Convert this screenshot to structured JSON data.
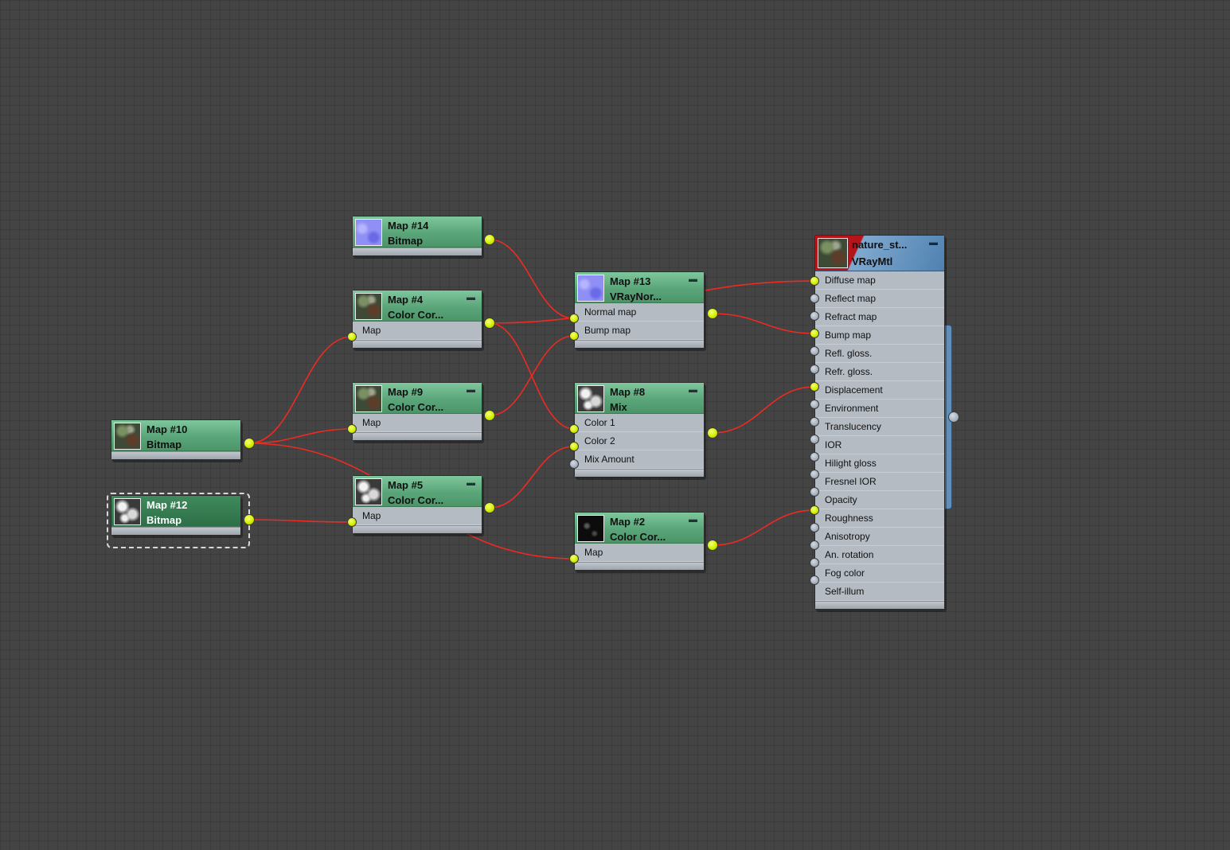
{
  "nodes": {
    "map14": {
      "name": "Map #14",
      "type": "Bitmap",
      "thumbnail": "normal-map-icon"
    },
    "map4": {
      "name": "Map #4",
      "type": "Color Cor...",
      "thumbnail": "stone-texture-icon",
      "slots": [
        "Map"
      ]
    },
    "map9": {
      "name": "Map #9",
      "type": "Color Cor...",
      "thumbnail": "stone-texture-icon",
      "slots": [
        "Map"
      ]
    },
    "map10": {
      "name": "Map #10",
      "type": "Bitmap",
      "thumbnail": "stone-texture-icon"
    },
    "map12": {
      "name": "Map #12",
      "type": "Bitmap",
      "thumbnail": "bw-texture-icon",
      "selected": true
    },
    "map5": {
      "name": "Map #5",
      "type": "Color Cor...",
      "thumbnail": "bw-texture-icon",
      "slots": [
        "Map"
      ]
    },
    "map13": {
      "name": "Map #13",
      "type": "VRayNor...",
      "thumbnail": "normal-map-icon",
      "slots": [
        "Normal map",
        "Bump map"
      ]
    },
    "map8": {
      "name": "Map #8",
      "type": "Mix",
      "thumbnail": "bw-texture-icon",
      "slots": [
        "Color 1",
        "Color 2",
        "Mix Amount"
      ]
    },
    "map2": {
      "name": "Map #2",
      "type": "Color Cor...",
      "thumbnail": "dark-texture-icon",
      "slots": [
        "Map"
      ]
    },
    "mtl": {
      "name": "nature_st...",
      "type": "VRayMtl",
      "thumbnail": "stone-material-icon",
      "slots": [
        "Diffuse map",
        "Reflect map",
        "Refract map",
        "Bump map",
        "Refl. gloss.",
        "Refr. gloss.",
        "Displacement",
        "Environment",
        "Translucency",
        "IOR",
        "Hilight gloss",
        "Fresnel IOR",
        "Opacity",
        "Roughness",
        "Anisotropy",
        "An. rotation",
        "Fog color",
        "Self-illum"
      ]
    }
  },
  "colors": {
    "wire": "#ee2a22",
    "socket_connected": "#d4f000",
    "socket_empty": "#a6b1bf",
    "node_header": "#5aa579",
    "material_header": "#4f81b0",
    "material_header_warning": "#b5141b",
    "canvas": "#444444"
  },
  "connections": [
    {
      "from": "map14",
      "to": "map13",
      "slot": "Normal map"
    },
    {
      "from": "map4",
      "to": "mtl",
      "slot": "Diffuse map"
    },
    {
      "from": "map4",
      "to": "map8",
      "slot": "Color 1"
    },
    {
      "from": "map9",
      "to": "map13",
      "slot": "Bump map"
    },
    {
      "from": "map10",
      "to": "map4",
      "slot": "Map"
    },
    {
      "from": "map10",
      "to": "map9",
      "slot": "Map"
    },
    {
      "from": "map10",
      "to": "map2",
      "slot": "Map"
    },
    {
      "from": "map12",
      "to": "map5",
      "slot": "Map"
    },
    {
      "from": "map5",
      "to": "map8",
      "slot": "Color 2"
    },
    {
      "from": "map13",
      "to": "mtl",
      "slot": "Bump map"
    },
    {
      "from": "map8",
      "to": "mtl",
      "slot": "Displacement"
    },
    {
      "from": "map2",
      "to": "mtl",
      "slot": "Roughness"
    }
  ]
}
